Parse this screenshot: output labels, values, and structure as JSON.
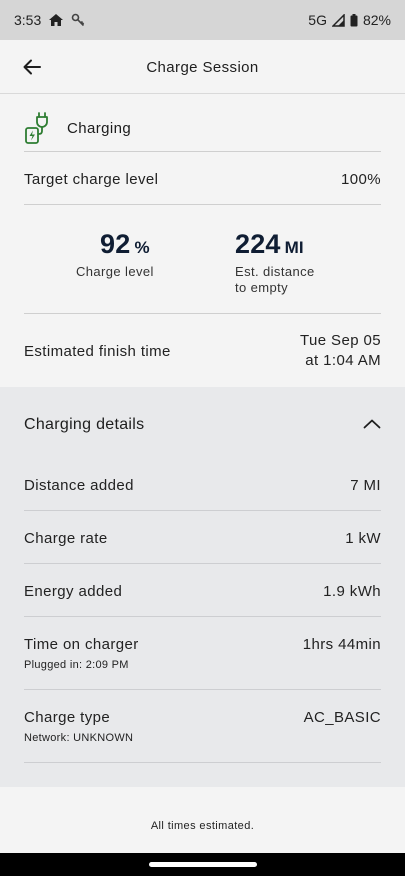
{
  "status_bar": {
    "time": "3:53",
    "network": "5G",
    "battery": "82%",
    "icons": [
      "home-icon",
      "key-icon",
      "signal-icon",
      "battery-icon"
    ]
  },
  "header": {
    "title": "Charge Session",
    "back_icon": "arrow-left-icon"
  },
  "charging_status": {
    "icon": "plug-charging-icon",
    "label": "Charging",
    "accent_color": "#2e7d32"
  },
  "target": {
    "label": "Target charge level",
    "value": "100%"
  },
  "metrics": {
    "charge_level": {
      "value": "92",
      "unit": "%",
      "label": "Charge level"
    },
    "distance": {
      "value": "224",
      "unit": "MI",
      "label_line1": "Est. distance",
      "label_line2": "to empty"
    }
  },
  "finish": {
    "label": "Estimated finish time",
    "value_line1": "Tue Sep 05",
    "value_line2": "at 1:04 AM"
  },
  "details": {
    "title": "Charging details",
    "toggle_icon": "chevron-up-icon",
    "rows": [
      {
        "label": "Distance added",
        "value": "7 MI"
      },
      {
        "label": "Charge rate",
        "value": "1 kW"
      },
      {
        "label": "Energy added",
        "value": "1.9 kWh"
      },
      {
        "label": "Time on charger",
        "value": "1hrs 44min",
        "sub": "Plugged in: 2:09 PM"
      },
      {
        "label": "Charge type",
        "value": "AC_BASIC",
        "sub": "Network: UNKNOWN"
      }
    ]
  },
  "footer": {
    "note": "All times estimated."
  }
}
